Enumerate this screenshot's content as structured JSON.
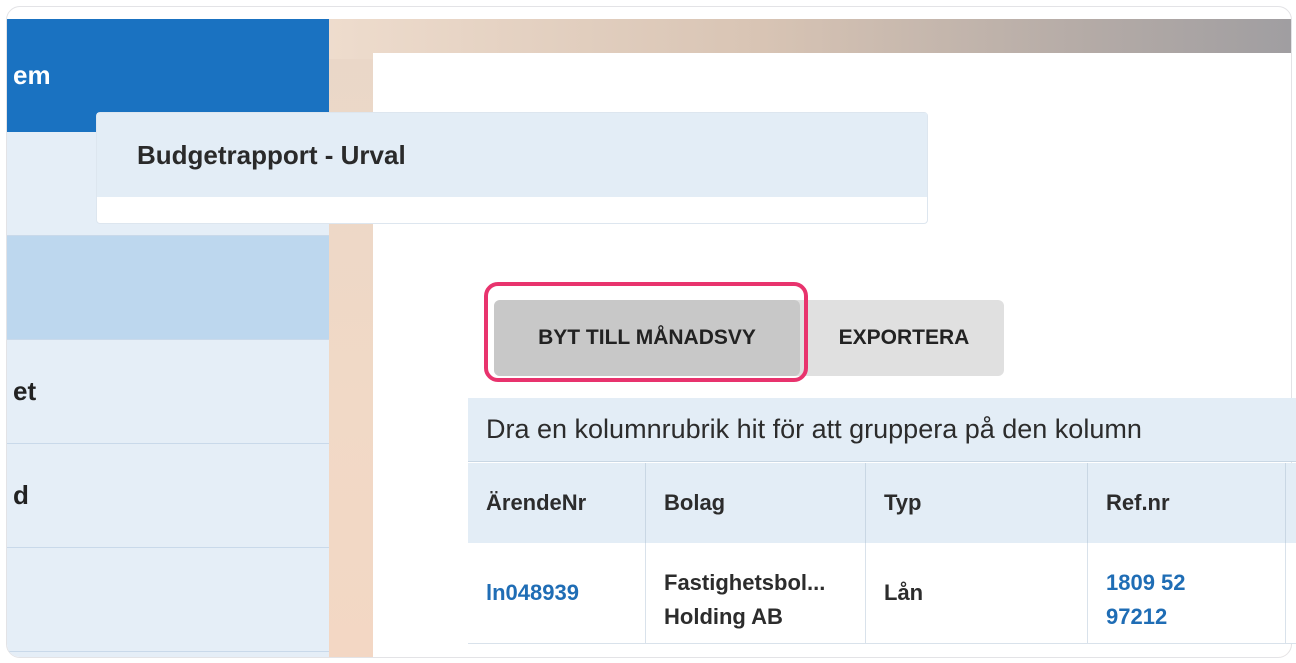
{
  "sidebar": {
    "header": "em",
    "items": [
      {
        "label": ""
      },
      {
        "label": ""
      },
      {
        "label": "et"
      },
      {
        "label": "d"
      },
      {
        "label": ""
      }
    ]
  },
  "report": {
    "title": "Budgetrapport - Urval"
  },
  "toolbar": {
    "month_view_label": "BYT TILL MÅNADSVY",
    "export_label": "EXPORTERA"
  },
  "grid": {
    "group_hint": "Dra en kolumnrubrik hit för att gruppera på den kolumn",
    "columns": [
      "ÄrendeNr",
      "Bolag",
      "Typ",
      "Ref.nr"
    ],
    "rows": [
      {
        "arende": "ln048939",
        "bolag_line1": "Fastighetsbol...",
        "bolag_line2": "Holding AB",
        "typ": "Lån",
        "ref_line1": "1809 52",
        "ref_line2": "97212"
      }
    ]
  },
  "colors": {
    "sidebar_header": "#1a72c1",
    "highlight": "#e8336d",
    "link": "#1f6db5"
  }
}
